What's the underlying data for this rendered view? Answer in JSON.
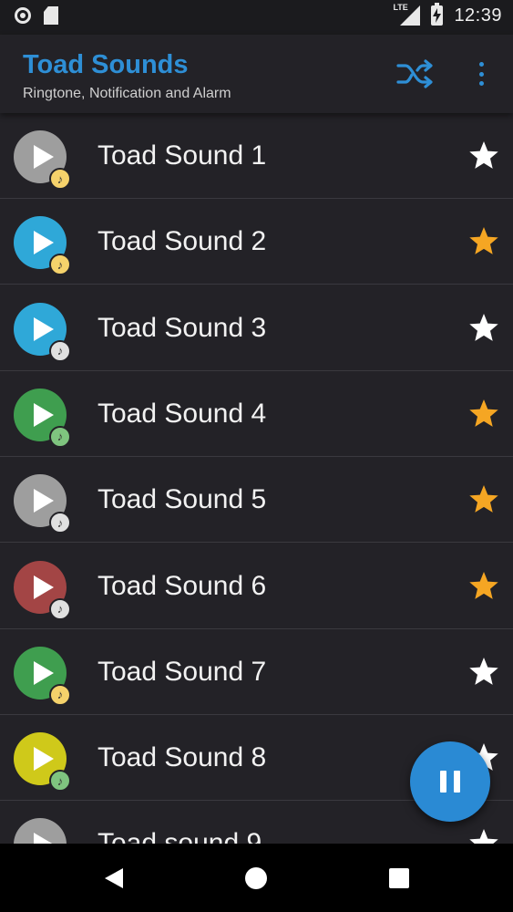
{
  "status_bar": {
    "network_label": "LTE",
    "time": "12:39"
  },
  "app_bar": {
    "title": "Toad Sounds",
    "subtitle": "Ringtone, Notification and Alarm",
    "shuffle_icon": "shuffle-icon",
    "more_icon": "more-vert-icon"
  },
  "colors": {
    "accent": "#2e8fd6",
    "background": "#232227",
    "star_favorite": "#f5a623",
    "star_default": "#ffffff"
  },
  "sounds": [
    {
      "label": "Toad Sound 1",
      "play_color": "#9e9e9e",
      "badge_color": "#f5d26b",
      "favorite": false
    },
    {
      "label": "Toad Sound 2",
      "play_color": "#2fa8d8",
      "badge_color": "#f5d26b",
      "favorite": true
    },
    {
      "label": "Toad Sound 3",
      "play_color": "#2fa8d8",
      "badge_color": "#e0e0e0",
      "favorite": false
    },
    {
      "label": "Toad Sound 4",
      "play_color": "#3f9e4f",
      "badge_color": "#7fc47f",
      "favorite": true
    },
    {
      "label": "Toad Sound 5",
      "play_color": "#9e9e9e",
      "badge_color": "#e0e0e0",
      "favorite": true
    },
    {
      "label": "Toad Sound 6",
      "play_color": "#a34545",
      "badge_color": "#e0e0e0",
      "favorite": true
    },
    {
      "label": "Toad Sound 7",
      "play_color": "#3f9e4f",
      "badge_color": "#f5d26b",
      "favorite": false
    },
    {
      "label": "Toad Sound 8",
      "play_color": "#cfc91a",
      "badge_color": "#7fc47f",
      "favorite": false
    },
    {
      "label": "Toad sound 9",
      "play_color": "#9e9e9e",
      "badge_color": "#e0e0e0",
      "favorite": false
    }
  ],
  "fab": {
    "icon": "pause-icon"
  },
  "nav_bar": {
    "back_icon": "back-icon",
    "home_icon": "home-icon",
    "recents_icon": "recents-icon"
  }
}
